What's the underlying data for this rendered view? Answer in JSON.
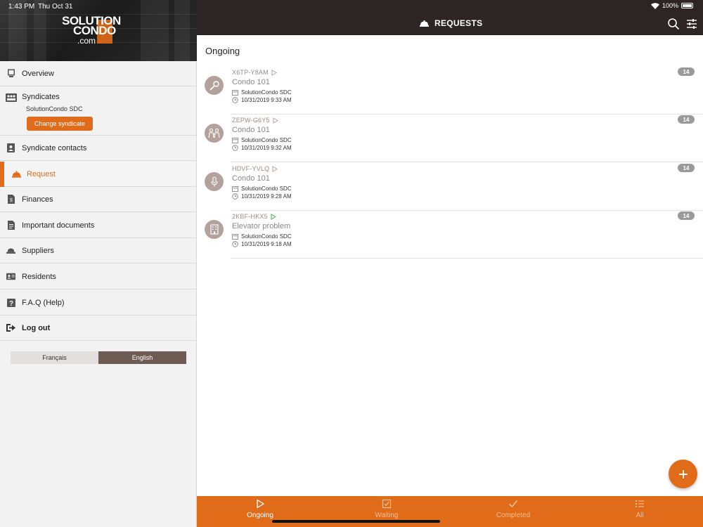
{
  "status_bar": {
    "time": "1:43 PM",
    "date": "Thu Oct 31",
    "battery": "100%"
  },
  "logo": {
    "line1": "SOLUTION",
    "line2": "CONDO",
    "line3": ".com"
  },
  "sidebar": {
    "overview": "Overview",
    "syndicates": "Syndicates",
    "syndicate_name": "SolutionCondo SDC",
    "change_syndicate": "Change syndicate",
    "items": [
      {
        "label": "Syndicate contacts",
        "icon": "contact-card-icon"
      },
      {
        "label": "Request",
        "icon": "service-bell-icon",
        "active": true
      },
      {
        "label": "Finances",
        "icon": "finance-document-icon"
      },
      {
        "label": "Important documents",
        "icon": "document-icon"
      },
      {
        "label": "Suppliers",
        "icon": "hard-hat-icon"
      },
      {
        "label": "Residents",
        "icon": "id-card-icon"
      },
      {
        "label": "F.A.Q (Help)",
        "icon": "question-icon"
      },
      {
        "label": "Log out",
        "icon": "logout-icon"
      }
    ],
    "languages": {
      "fr": "Français",
      "en": "English",
      "selected": "en"
    }
  },
  "header": {
    "title": "REQUESTS"
  },
  "main": {
    "section_heading": "Ongoing",
    "requests": [
      {
        "code": "X6TP-Y8AM",
        "title": "Condo 101",
        "syndicate": "SolutionCondo SDC",
        "datetime": "10/31/2019 9:33 AM",
        "count": "14",
        "icon": "wrench-icon",
        "status_color": "#b3a29b"
      },
      {
        "code": "ZEPW-G6Y5",
        "title": "Condo 101",
        "syndicate": "SolutionCondo SDC",
        "datetime": "10/31/2019 9:32 AM",
        "count": "14",
        "icon": "people-icon",
        "status_color": "#b3a29b"
      },
      {
        "code": "HDVF-YVLQ",
        "title": "Condo 101",
        "syndicate": "SolutionCondo SDC",
        "datetime": "10/31/2019 9:28 AM",
        "count": "14",
        "icon": "microphone-icon",
        "status_color": "#b3a29b"
      },
      {
        "code": "2KBF-HKX5",
        "title": "Elevator problem",
        "syndicate": "SolutionCondo SDC",
        "datetime": "10/31/2019 9:18 AM",
        "count": "14",
        "icon": "building-icon",
        "status_color": "#4caf50"
      }
    ]
  },
  "tabs": [
    {
      "label": "Ongoing",
      "icon": "play-icon",
      "active": true
    },
    {
      "label": "Waiting",
      "icon": "checkbox-icon"
    },
    {
      "label": "Completed",
      "icon": "checkmark-icon"
    },
    {
      "label": "All",
      "icon": "list-icon"
    }
  ],
  "colors": {
    "accent": "#e06c19",
    "topbar": "#2c2523",
    "language_selected": "#6e5b53"
  }
}
